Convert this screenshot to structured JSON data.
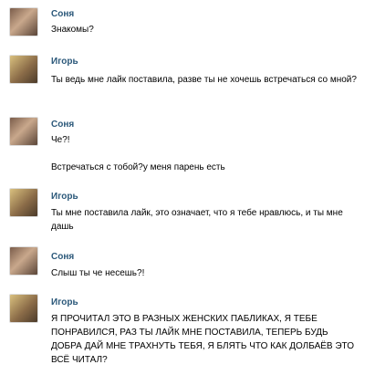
{
  "messages": [
    {
      "author": "Соня",
      "text": "Знакомы?"
    },
    {
      "author": "Игорь",
      "text": "Ты ведь мне лайк поставила, разве ты не хочешь встречаться со мной?"
    },
    {
      "author": "Соня",
      "text": "Че?!"
    },
    {
      "author": "",
      "text": "Встречаться с тобой?у меня парень есть"
    },
    {
      "author": "Игорь",
      "text": "Ты мне поставила лайк, это означает, что я тебе нравлюсь, и ты мне дашь"
    },
    {
      "author": "Соня",
      "text": "Слыш ты че несешь?!"
    },
    {
      "author": "Игорь",
      "text": "Я ПРОЧИТАЛ ЭТО В РАЗНЫХ ЖЕНСКИХ ПАБЛИКАХ, Я ТЕБЕ ПОНРАВИЛСЯ, РАЗ ТЫ ЛАЙК МНЕ ПОСТАВИЛА, ТЕПЕРЬ БУДЬ ДОБРА ДАЙ МНЕ ТРАХНУТЬ ТЕБЯ, Я БЛЯТЬ ЧТО КАК ДОЛБАЁВ ЭТО ВСЁ ЧИТАЛ?"
    }
  ]
}
